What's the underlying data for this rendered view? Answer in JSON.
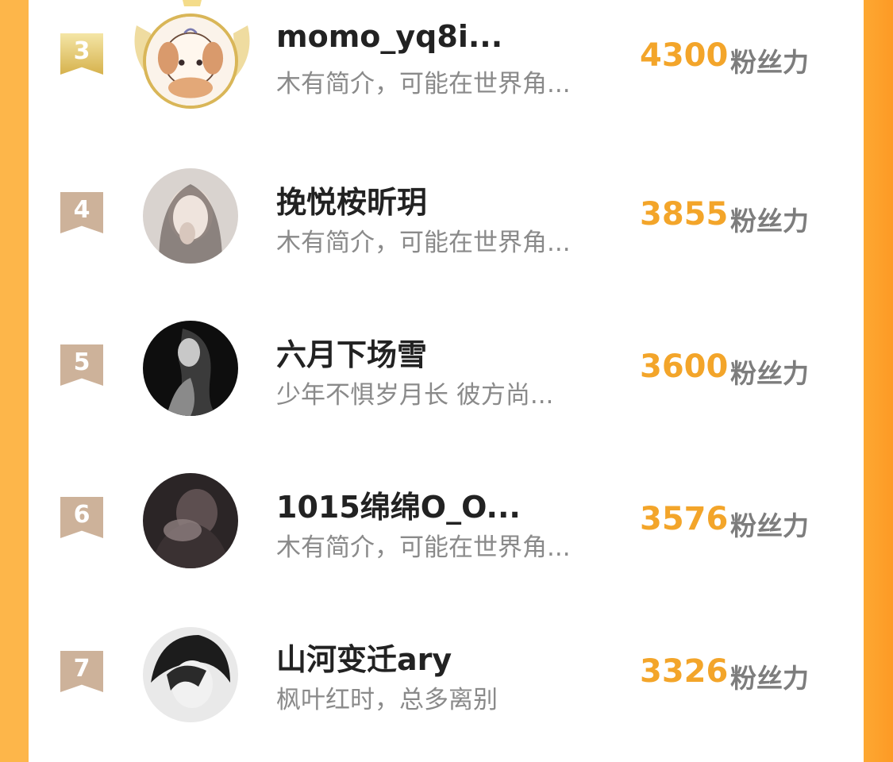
{
  "ranking": {
    "entries": [
      {
        "rank": "3",
        "name": "momo_yq8i...",
        "bio": "木有简介，可能在世界角...",
        "score": "4300",
        "unit": "粉丝力",
        "frame": "gold-laurel"
      },
      {
        "rank": "4",
        "name": "挽悦桉昕玥",
        "bio": "木有简介，可能在世界角...",
        "score": "3855",
        "unit": "粉丝力"
      },
      {
        "rank": "5",
        "name": "六月下场雪",
        "bio": "少年不惧岁月长 彼方尚...",
        "score": "3600",
        "unit": "粉丝力"
      },
      {
        "rank": "6",
        "name": "1015绵绵O_O...",
        "bio": "木有简介，可能在世界角...",
        "score": "3576",
        "unit": "粉丝力"
      },
      {
        "rank": "7",
        "name": "山河变迁ary",
        "bio": "枫叶红时，总多离别",
        "score": "3326",
        "unit": "粉丝力"
      }
    ]
  },
  "colors": {
    "score": "#f3a52a",
    "gold_flag": "#d6b24d",
    "flag": "#cdb29a",
    "background": "#fdb64a"
  }
}
